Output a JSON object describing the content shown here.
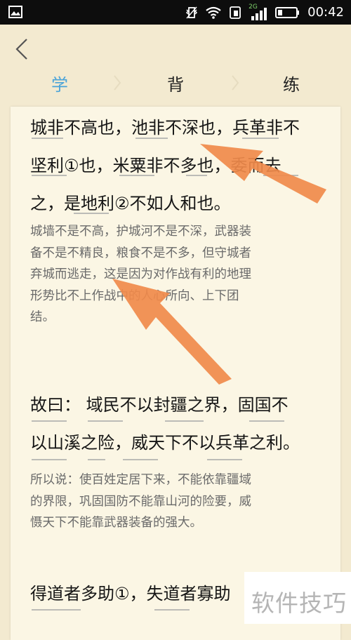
{
  "status_bar": {
    "time": "00:42",
    "network_label": "2G",
    "icons": [
      "gallery-icon",
      "vibrate-icon",
      "wifi-icon",
      "sim-icon",
      "signal-icon",
      "battery-icon"
    ]
  },
  "header": {
    "back_icon": "chevron-left-icon",
    "tabs": [
      {
        "label": "学",
        "active": true
      },
      {
        "label": "背",
        "active": false
      },
      {
        "label": "练",
        "active": false
      }
    ],
    "accent_color": "#4aa3d8"
  },
  "passages": [
    {
      "original_lines": [
        "城非不高也，池非不深也，兵革非不",
        "坚利①也，米粟非不多也，委而去",
        "之，是地利②不如人和也。"
      ],
      "translation_lines": [
        "城墙不是不高，护城河不是不深，武器装",
        "备不是不精良，粮食不是不多，但守城者",
        "弃城而逃走，这是因为对作战有利的地理",
        "形势比不上作战中的人心所向、上下团",
        "结。"
      ]
    },
    {
      "original_lines": [
        "故曰：  域民不以封疆之界，固国不",
        "以山溪之险，威天下不以兵革之利。"
      ],
      "translation_lines": [
        "所以说：使百姓定居下来，不能依靠疆域",
        "的界限，巩固国防不能靠山河的险要，威",
        "慑天下不能靠武器装备的强大。"
      ]
    },
    {
      "original_lines": [
        "得道者多助①，失道者寡助"
      ],
      "translation_lines": []
    }
  ],
  "annotation_color": "#f08a4b",
  "watermark": "软件技巧"
}
